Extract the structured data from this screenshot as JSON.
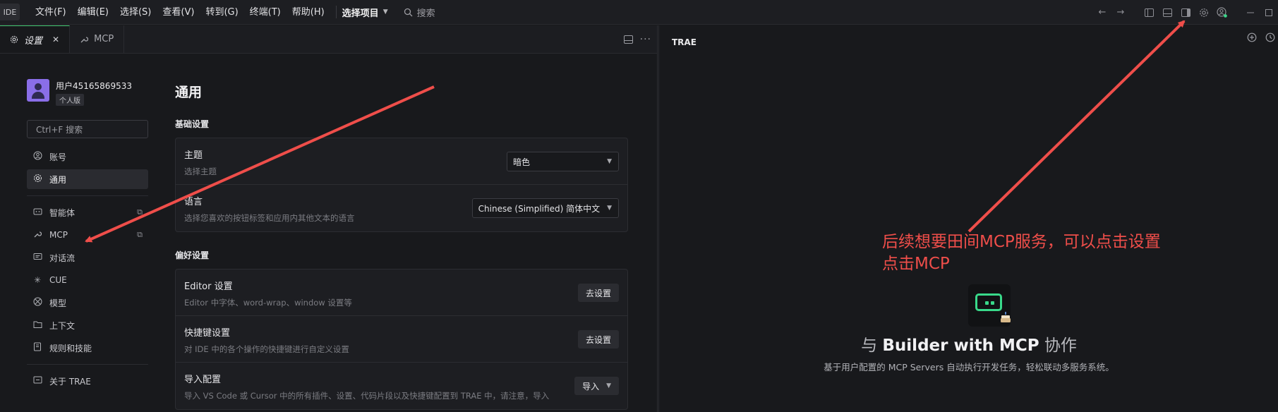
{
  "titlebar": {
    "logo": "IDE",
    "menu": [
      "文件(F)",
      "编辑(E)",
      "选择(S)",
      "查看(V)",
      "转到(G)",
      "终端(T)",
      "帮助(H)"
    ],
    "project": "选择项目",
    "search_placeholder": "搜索"
  },
  "tabs": [
    {
      "label": "设置",
      "active": true
    },
    {
      "label": "MCP",
      "active": false
    }
  ],
  "nav": {
    "user_name": "用户45165869533",
    "user_badge": "个人版",
    "search_placeholder": "Ctrl+F 搜索",
    "items": [
      {
        "label": "账号"
      },
      {
        "label": "通用"
      },
      {
        "label": "智能体"
      },
      {
        "label": "MCP"
      },
      {
        "label": "对话流"
      },
      {
        "label": "CUE"
      },
      {
        "label": "模型"
      },
      {
        "label": "上下文"
      },
      {
        "label": "规则和技能"
      },
      {
        "label": "关于 TRAE"
      }
    ]
  },
  "content": {
    "title": "通用",
    "sections": [
      {
        "heading": "基础设置",
        "rows": [
          {
            "title": "主题",
            "desc": "选择主题",
            "control": "暗色"
          },
          {
            "title": "语言",
            "desc": "选择您喜欢的按钮标签和应用内其他文本的语言",
            "control": "Chinese (Simplified) 简体中文"
          }
        ]
      },
      {
        "heading": "偏好设置",
        "rows": [
          {
            "title": "Editor 设置",
            "desc": "Editor 中字体、word-wrap、window 设置等",
            "control": "去设置"
          },
          {
            "title": "快捷键设置",
            "desc": "对 IDE 中的各个操作的快捷键进行自定义设置",
            "control": "去设置"
          },
          {
            "title": "导入配置",
            "desc": "导入 VS Code 或 Cursor 中的所有插件、设置、代码片段以及快捷键配置到 TRAE 中，请注意，导入",
            "control": "导入"
          }
        ]
      }
    ]
  },
  "right_panel": {
    "title": "TRAE",
    "heading_pre": "与",
    "heading_mid": "Builder with MCP",
    "heading_post": "协作",
    "subtitle": "基于用户配置的 MCP Servers 自动执行开发任务，轻松联动多服务系统。"
  },
  "annotation": {
    "line1": "后续想要田间MCP服务，可以点击设置",
    "line2": "点击MCP",
    "color": "#ef4e4a"
  },
  "colors": {
    "accent_green": "#39d98a",
    "annotation_red": "#ef4e4a",
    "avatar_purple": "#8a6ee8"
  }
}
